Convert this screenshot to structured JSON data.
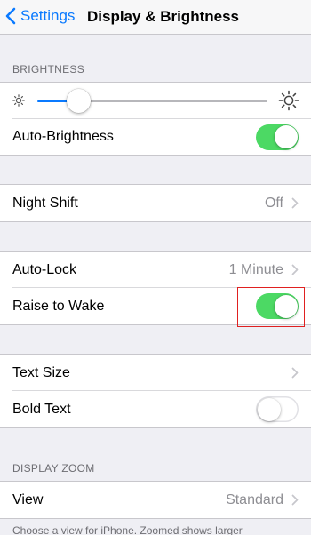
{
  "navbar": {
    "back_label": "Settings",
    "title": "Display & Brightness"
  },
  "brightness": {
    "header": "BRIGHTNESS",
    "level": 0.18,
    "auto_brightness_label": "Auto-Brightness",
    "auto_brightness_on": true
  },
  "night_shift": {
    "label": "Night Shift",
    "value": "Off"
  },
  "lock": {
    "auto_lock_label": "Auto-Lock",
    "auto_lock_value": "1 Minute",
    "raise_to_wake_label": "Raise to Wake",
    "raise_to_wake_on": true
  },
  "text": {
    "text_size_label": "Text Size",
    "bold_text_label": "Bold Text",
    "bold_text_on": false
  },
  "zoom": {
    "header": "DISPLAY ZOOM",
    "view_label": "View",
    "view_value": "Standard",
    "footer": "Choose a view for iPhone. Zoomed shows larger"
  },
  "colors": {
    "accent": "#0a7aff",
    "toggle_on": "#4cd964",
    "highlight": "#e02020"
  },
  "icons": [
    "chevron-left-icon",
    "sun-small-icon",
    "sun-large-icon",
    "chevron-right-icon"
  ]
}
